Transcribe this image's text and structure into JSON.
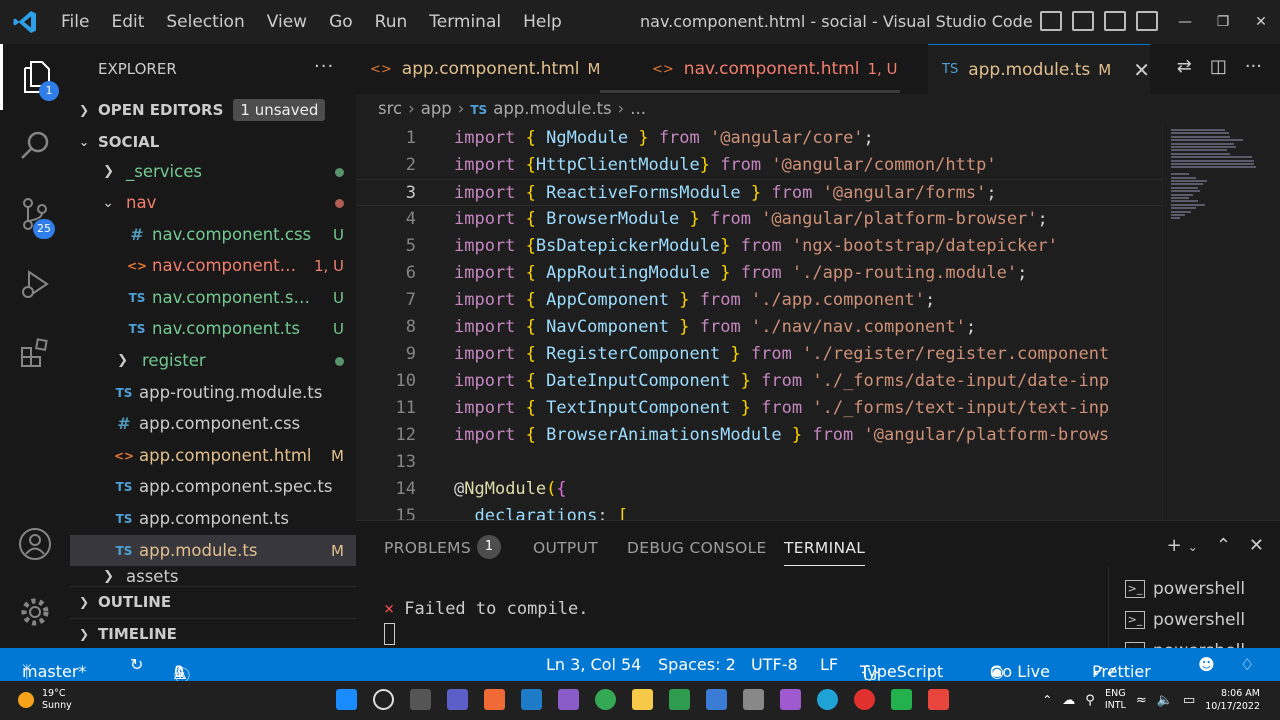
{
  "titlebar": {
    "menu": [
      "File",
      "Edit",
      "Selection",
      "View",
      "Go",
      "Run",
      "Terminal",
      "Help"
    ],
    "window_title": "nav.component.html - social - Visual Studio Code"
  },
  "activity": {
    "explorer_badge": "1",
    "scm_badge": "25"
  },
  "sidebar": {
    "title": "EXPLORER",
    "open_editors": "OPEN EDITORS",
    "unsaved_badge": "1 unsaved",
    "folder": "SOCIAL",
    "tree": [
      {
        "icon": "",
        "name": "_services",
        "status": "",
        "color": "green",
        "chev": ">"
      },
      {
        "icon": "",
        "name": "nav",
        "status": "",
        "color": "red",
        "chev": "v"
      },
      {
        "icon": "#",
        "name": "nav.component.css",
        "status": "U",
        "color": "green"
      },
      {
        "icon": "<>",
        "name": "nav.component.html",
        "status": "1, U",
        "color": "red"
      },
      {
        "icon": "TS",
        "name": "nav.component.spec.ts",
        "status": "U",
        "color": "green"
      },
      {
        "icon": "TS",
        "name": "nav.component.ts",
        "status": "U",
        "color": "green"
      },
      {
        "icon": "",
        "name": "register",
        "status": "",
        "color": "green",
        "chev": ">"
      },
      {
        "icon": "TS",
        "name": "app-routing.module.ts",
        "status": "",
        "color": "plain"
      },
      {
        "icon": "#",
        "name": "app.component.css",
        "status": "",
        "color": "plain"
      },
      {
        "icon": "<>",
        "name": "app.component.html",
        "status": "M",
        "color": "mod"
      },
      {
        "icon": "TS",
        "name": "app.component.spec.ts",
        "status": "",
        "color": "plain"
      },
      {
        "icon": "TS",
        "name": "app.component.ts",
        "status": "",
        "color": "plain"
      },
      {
        "icon": "TS",
        "name": "app.module.ts",
        "status": "M",
        "color": "mod"
      },
      {
        "icon": "",
        "name": "assets",
        "status": "",
        "color": "plain",
        "chev": ">"
      }
    ],
    "outline": "OUTLINE",
    "timeline": "TIMELINE"
  },
  "tabs": [
    {
      "icon": "<>",
      "label": "app.component.html",
      "status": "M"
    },
    {
      "icon": "<>",
      "label": "nav.component.html",
      "status": "1, U"
    },
    {
      "icon": "TS",
      "label": "app.module.ts",
      "status": "M"
    }
  ],
  "breadcrumb": {
    "p1": "src",
    "p2": "app",
    "icon": "TS",
    "p3": "app.module.ts",
    "p4": "..."
  },
  "code": [
    {
      "n": "1",
      "s": [
        [
          "kw",
          "import"
        ],
        [
          "pl",
          " "
        ],
        [
          "br",
          "{"
        ],
        [
          "pl",
          " "
        ],
        [
          "id",
          "NgModule"
        ],
        [
          "pl",
          " "
        ],
        [
          "br",
          "}"
        ],
        [
          "pl",
          " "
        ],
        [
          "kw",
          "from"
        ],
        [
          "pl",
          " "
        ],
        [
          "str",
          "'@angular/core'"
        ],
        [
          "pl",
          ";"
        ]
      ]
    },
    {
      "n": "2",
      "s": [
        [
          "kw",
          "import"
        ],
        [
          "pl",
          " "
        ],
        [
          "br",
          "{"
        ],
        [
          "id",
          "HttpClientModule"
        ],
        [
          "br",
          "}"
        ],
        [
          "pl",
          " "
        ],
        [
          "kw",
          "from"
        ],
        [
          "pl",
          " "
        ],
        [
          "str",
          "'@angular/common/http'"
        ]
      ]
    },
    {
      "n": "3",
      "s": [
        [
          "kw",
          "import"
        ],
        [
          "pl",
          " "
        ],
        [
          "br",
          "{"
        ],
        [
          "pl",
          " "
        ],
        [
          "id",
          "ReactiveFormsModule"
        ],
        [
          "pl",
          " "
        ],
        [
          "br",
          "}"
        ],
        [
          "pl",
          " "
        ],
        [
          "kw",
          "from"
        ],
        [
          "pl",
          " "
        ],
        [
          "str",
          "'@angular/forms'"
        ],
        [
          "pl",
          ";"
        ]
      ]
    },
    {
      "n": "4",
      "s": [
        [
          "kw",
          "import"
        ],
        [
          "pl",
          " "
        ],
        [
          "br",
          "{"
        ],
        [
          "pl",
          " "
        ],
        [
          "id",
          "BrowserModule"
        ],
        [
          "pl",
          " "
        ],
        [
          "br",
          "}"
        ],
        [
          "pl",
          " "
        ],
        [
          "kw",
          "from"
        ],
        [
          "pl",
          " "
        ],
        [
          "str",
          "'@angular/platform-browser'"
        ],
        [
          "pl",
          ";"
        ]
      ]
    },
    {
      "n": "5",
      "s": [
        [
          "kw",
          "import"
        ],
        [
          "pl",
          " "
        ],
        [
          "br",
          "{"
        ],
        [
          "id",
          "BsDatepickerModule"
        ],
        [
          "br",
          "}"
        ],
        [
          "pl",
          " "
        ],
        [
          "kw",
          "from"
        ],
        [
          "pl",
          " "
        ],
        [
          "str",
          "'ngx-bootstrap/datepicker'"
        ]
      ]
    },
    {
      "n": "6",
      "s": [
        [
          "kw",
          "import"
        ],
        [
          "pl",
          " "
        ],
        [
          "br",
          "{"
        ],
        [
          "pl",
          " "
        ],
        [
          "id",
          "AppRoutingModule"
        ],
        [
          "pl",
          " "
        ],
        [
          "br",
          "}"
        ],
        [
          "pl",
          " "
        ],
        [
          "kw",
          "from"
        ],
        [
          "pl",
          " "
        ],
        [
          "str",
          "'./app-routing.module'"
        ],
        [
          "pl",
          ";"
        ]
      ]
    },
    {
      "n": "7",
      "s": [
        [
          "kw",
          "import"
        ],
        [
          "pl",
          " "
        ],
        [
          "br",
          "{"
        ],
        [
          "pl",
          " "
        ],
        [
          "id",
          "AppComponent"
        ],
        [
          "pl",
          " "
        ],
        [
          "br",
          "}"
        ],
        [
          "pl",
          " "
        ],
        [
          "kw",
          "from"
        ],
        [
          "pl",
          " "
        ],
        [
          "str",
          "'./app.component'"
        ],
        [
          "pl",
          ";"
        ]
      ]
    },
    {
      "n": "8",
      "s": [
        [
          "kw",
          "import"
        ],
        [
          "pl",
          " "
        ],
        [
          "br",
          "{"
        ],
        [
          "pl",
          " "
        ],
        [
          "id",
          "NavComponent"
        ],
        [
          "pl",
          " "
        ],
        [
          "br",
          "}"
        ],
        [
          "pl",
          " "
        ],
        [
          "kw",
          "from"
        ],
        [
          "pl",
          " "
        ],
        [
          "str",
          "'./nav/nav.component'"
        ],
        [
          "pl",
          ";"
        ]
      ]
    },
    {
      "n": "9",
      "s": [
        [
          "kw",
          "import"
        ],
        [
          "pl",
          " "
        ],
        [
          "br",
          "{"
        ],
        [
          "pl",
          " "
        ],
        [
          "id",
          "RegisterComponent"
        ],
        [
          "pl",
          " "
        ],
        [
          "br",
          "}"
        ],
        [
          "pl",
          " "
        ],
        [
          "kw",
          "from"
        ],
        [
          "pl",
          " "
        ],
        [
          "str",
          "'./register/register.component"
        ]
      ]
    },
    {
      "n": "10",
      "s": [
        [
          "kw",
          "import"
        ],
        [
          "pl",
          " "
        ],
        [
          "br",
          "{"
        ],
        [
          "pl",
          " "
        ],
        [
          "id",
          "DateInputComponent"
        ],
        [
          "pl",
          " "
        ],
        [
          "br",
          "}"
        ],
        [
          "pl",
          " "
        ],
        [
          "kw",
          "from"
        ],
        [
          "pl",
          " "
        ],
        [
          "str",
          "'./_forms/date-input/date-inp"
        ]
      ]
    },
    {
      "n": "11",
      "s": [
        [
          "kw",
          "import"
        ],
        [
          "pl",
          " "
        ],
        [
          "br",
          "{"
        ],
        [
          "pl",
          " "
        ],
        [
          "id",
          "TextInputComponent"
        ],
        [
          "pl",
          " "
        ],
        [
          "br",
          "}"
        ],
        [
          "pl",
          " "
        ],
        [
          "kw",
          "from"
        ],
        [
          "pl",
          " "
        ],
        [
          "str",
          "'./_forms/text-input/text-inp"
        ]
      ]
    },
    {
      "n": "12",
      "s": [
        [
          "kw",
          "import"
        ],
        [
          "pl",
          " "
        ],
        [
          "br",
          "{"
        ],
        [
          "pl",
          " "
        ],
        [
          "id",
          "BrowserAnimationsModule"
        ],
        [
          "pl",
          " "
        ],
        [
          "br",
          "}"
        ],
        [
          "pl",
          " "
        ],
        [
          "kw",
          "from"
        ],
        [
          "pl",
          " "
        ],
        [
          "str",
          "'@angular/platform-brows"
        ]
      ]
    },
    {
      "n": "13",
      "s": []
    },
    {
      "n": "14",
      "s": [
        [
          "pl",
          "@"
        ],
        [
          "dec",
          "NgModule"
        ],
        [
          "br",
          "("
        ],
        [
          "br2",
          "{"
        ]
      ]
    },
    {
      "n": "15",
      "s": [
        [
          "pl",
          "  "
        ],
        [
          "id",
          "declarations"
        ],
        [
          "pl",
          ": "
        ],
        [
          "br",
          "["
        ]
      ]
    }
  ],
  "current_line": "3",
  "panel": {
    "tabs": [
      "PROBLEMS",
      "OUTPUT",
      "DEBUG CONSOLE",
      "TERMINAL"
    ],
    "problems_count": "1",
    "terminal_line": "Failed to compile.",
    "shells": [
      "powershell",
      "powershell",
      "powershell"
    ]
  },
  "status": {
    "branch": "master*",
    "errors": "1",
    "warnings": "0",
    "position": "Ln 3, Col 54",
    "spaces": "Spaces: 2",
    "encoding": "UTF-8",
    "eol": "LF",
    "language": "TypeScript",
    "golive": "Go Live",
    "prettier": "Prettier"
  },
  "taskbar": {
    "temp": "19°C",
    "weather": "Sunny",
    "lang1": "ENG",
    "lang2": "INTL",
    "time": "8:06 AM",
    "date": "10/17/2022"
  },
  "colors": {
    "accent": "#0078d4",
    "statusbar": "#0078d4",
    "untracked": "#73c991",
    "error": "#f27e6e",
    "modified": "#e2c08d"
  }
}
